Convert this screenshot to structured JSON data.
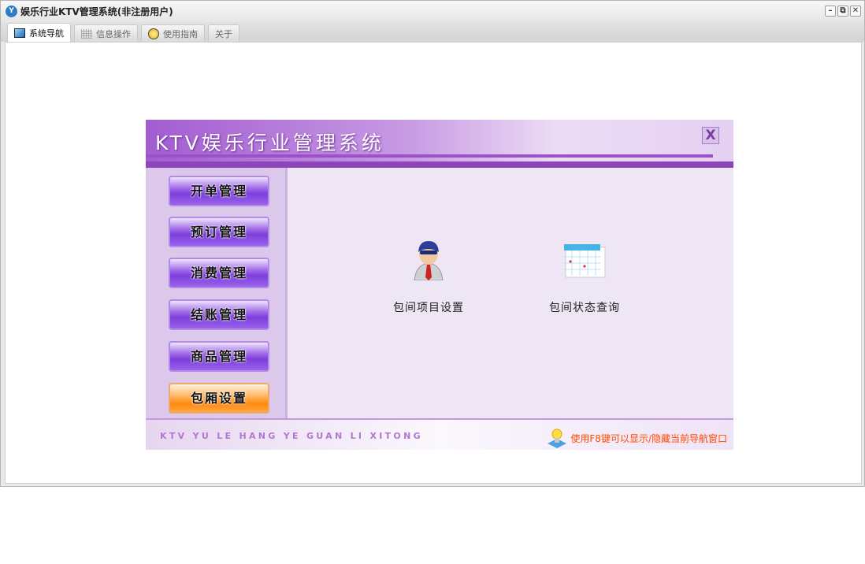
{
  "window": {
    "title": "娱乐行业KTV管理系统(非注册用户)",
    "controls": [
      "minimize",
      "restore",
      "close"
    ]
  },
  "tabs": [
    {
      "label": "系统导航",
      "icon": "monitor-icon"
    },
    {
      "label": "信息操作",
      "icon": "grid-icon"
    },
    {
      "label": "使用指南",
      "icon": "help-icon"
    },
    {
      "label": "关于"
    }
  ],
  "panel": {
    "title": "KTV娱乐行业管理系统",
    "close_label": "X",
    "menu": [
      {
        "label": "开单管理"
      },
      {
        "label": "预订管理"
      },
      {
        "label": "消费管理"
      },
      {
        "label": "结账管理"
      },
      {
        "label": "商品管理"
      },
      {
        "label": "包厢设置",
        "selected": true
      }
    ],
    "items": [
      {
        "label": "包间项目设置",
        "icon": "user-icon"
      },
      {
        "label": "包间状态查询",
        "icon": "calendar-icon"
      }
    ],
    "footer": {
      "pinyin": "KTV YU LE HANG YE GUAN LI XITONG",
      "tip": "使用F8键可以显示/隐藏当前导航窗口"
    }
  },
  "colors": {
    "accent": "#8e44bb",
    "selected": "#ff8a10",
    "tip": "#ff4a00"
  }
}
